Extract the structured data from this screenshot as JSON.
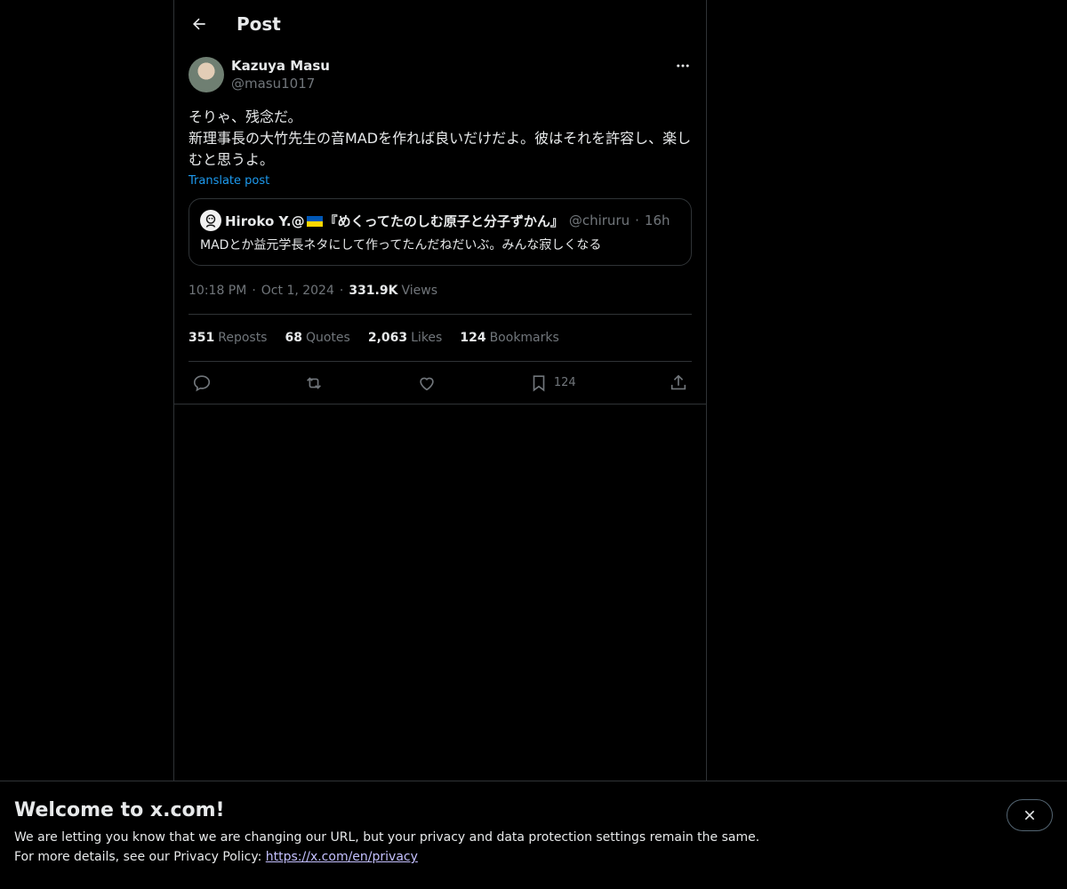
{
  "header": {
    "title": "Post"
  },
  "post": {
    "author_name": "Kazuya Masu",
    "author_handle": "@masu1017",
    "text": "そりゃ、残念だ。\n新理事長の大竹先生の音MADを作れば良いだけだよ。彼はそれを許容し、楽しむと思うよ。",
    "translate_label": "Translate post",
    "quote": {
      "name_part1": "Hiroko Y.@",
      "name_part2": "『めくってたのしむ原子と分子ずかん』",
      "handle": "@chiruru",
      "dot": "·",
      "time": "16h",
      "text": "MADとか益元学長ネタにして作ってたんだねだいぶ。みんな寂しくなる"
    },
    "time": "10:18 PM",
    "date": "Oct 1, 2024",
    "sep": "·",
    "views_count": "331.9K",
    "views_label": "Views"
  },
  "stats": [
    {
      "num": "351",
      "label": "Reposts"
    },
    {
      "num": "68",
      "label": "Quotes"
    },
    {
      "num": "2,063",
      "label": "Likes"
    },
    {
      "num": "124",
      "label": "Bookmarks"
    }
  ],
  "actions": {
    "bookmark_count": "124"
  },
  "banner": {
    "title": "Welcome to x.com!",
    "line1": "We are letting you know that we are changing our URL, but your privacy and data protection settings remain the same.",
    "line2_prefix": "For more details, see our Privacy Policy: ",
    "link": "https://x.com/en/privacy"
  },
  "colors": {
    "accent": "#1d9bf0",
    "muted": "#71767b",
    "text": "#e7e9ea",
    "border": "#2f3336"
  }
}
